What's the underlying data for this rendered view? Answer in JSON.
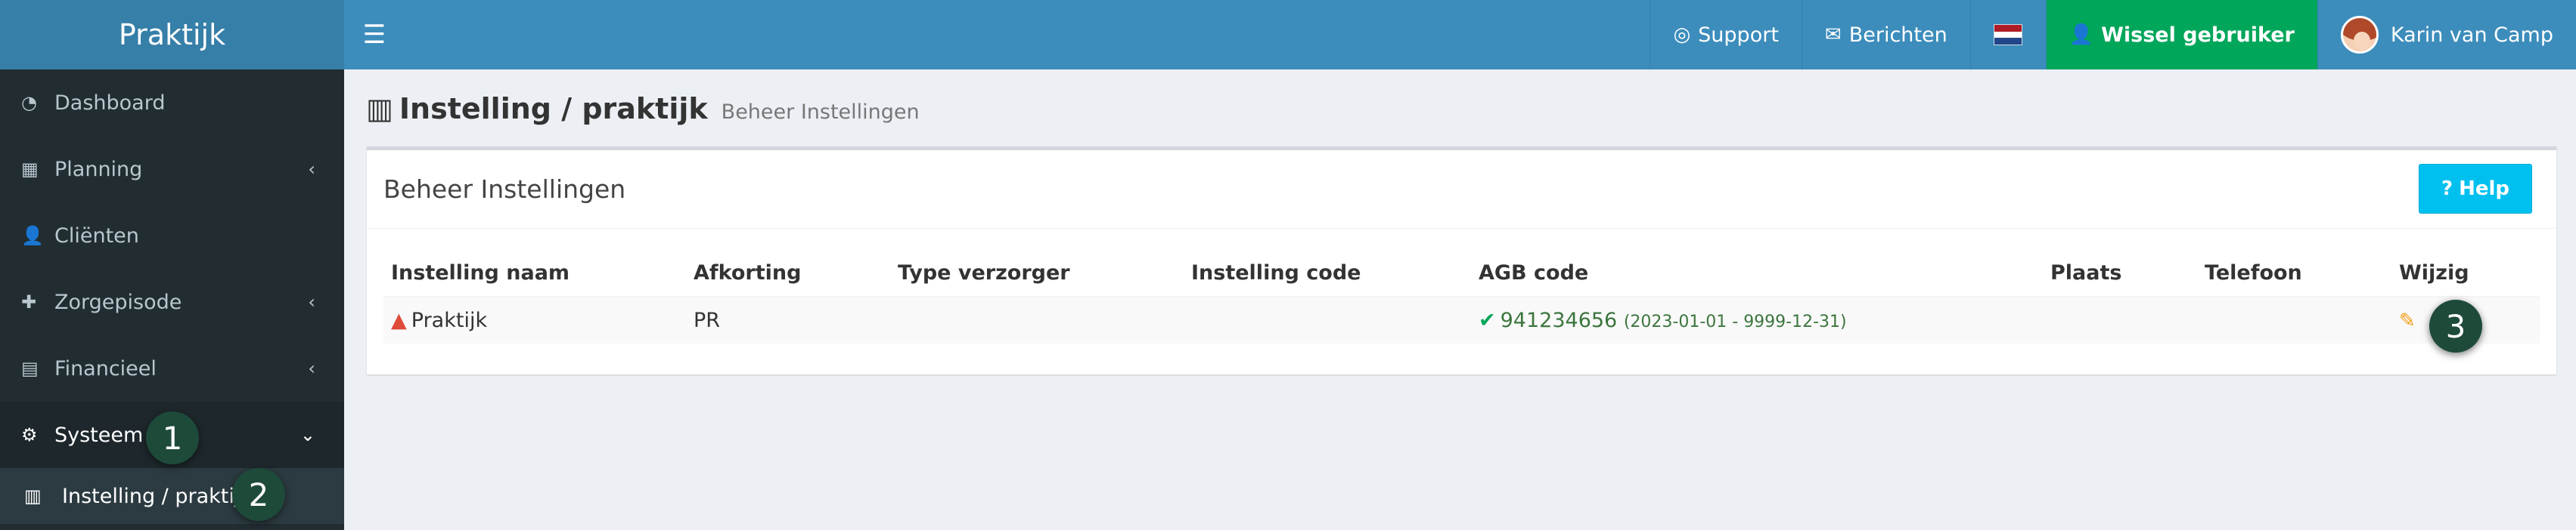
{
  "app": {
    "logo": "Praktijk",
    "menu_icon": "☰"
  },
  "topnav": {
    "support": "Support",
    "messages": "Berichten",
    "language": "nl-flag",
    "switch_user": "Wissel gebruiker",
    "user_name": "Karin van Camp"
  },
  "icons": {
    "support": "◎",
    "messages": "✉",
    "switch_user": "👤",
    "dashboard": "◔",
    "planning": "▦",
    "clients": "👤",
    "episode": "✚",
    "financial": "▤",
    "system": "⚙",
    "institution": "▥",
    "warning": "▲",
    "check": "✔",
    "edit": "✎",
    "help": "?",
    "chev_left": "‹",
    "chev_down": "⌄"
  },
  "colors": {
    "header": "#3c8dbc",
    "logo_bg": "#367fa9",
    "sidebar": "#222d32",
    "success": "#00a65a",
    "info": "#00c0ef"
  },
  "sidebar": {
    "items": [
      {
        "label": "Dashboard"
      },
      {
        "label": "Planning"
      },
      {
        "label": "Cliënten"
      },
      {
        "label": "Zorgepisode"
      },
      {
        "label": "Financieel"
      },
      {
        "label": "Systeem"
      }
    ],
    "sub_items": [
      {
        "label": "Instelling / praktijk"
      }
    ]
  },
  "badges": [
    "1",
    "2",
    "3"
  ],
  "page": {
    "title": "Instelling / praktijk",
    "subtitle": "Beheer Instellingen"
  },
  "box": {
    "title": "Beheer Instellingen",
    "help_label": "Help"
  },
  "table": {
    "headers": [
      "Instelling naam",
      "Afkorting",
      "Type verzorger",
      "Instelling code",
      "AGB code",
      "Plaats",
      "Telefoon",
      "Wijzig"
    ],
    "rows": [
      {
        "name": "Praktijk",
        "abbr": "PR",
        "type": "",
        "code": "",
        "agb": "941234656",
        "agb_range": "(2023-01-01 - 9999-12-31)",
        "place": "",
        "phone": ""
      }
    ]
  }
}
